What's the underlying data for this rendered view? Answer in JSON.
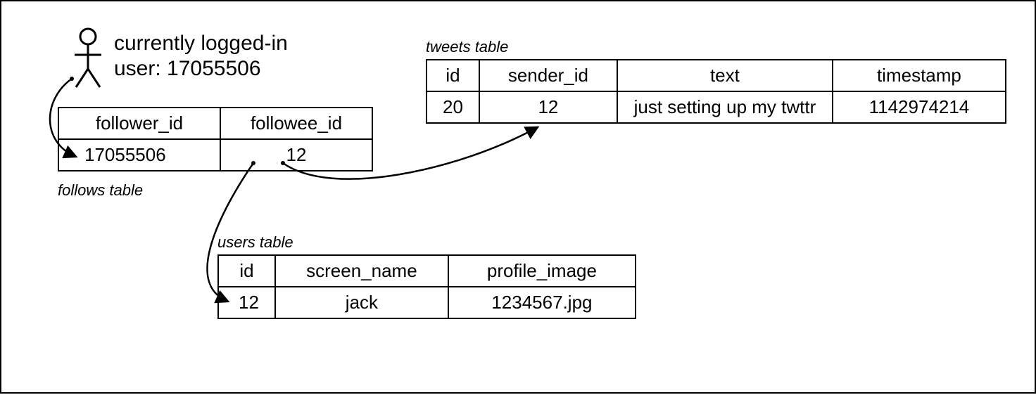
{
  "user": {
    "label_line1": "currently logged-in",
    "label_line2": "user: 17055506"
  },
  "follows": {
    "caption": "follows table",
    "headers": {
      "follower_id": "follower_id",
      "followee_id": "followee_id"
    },
    "row": {
      "follower_id": "17055506",
      "followee_id": "12"
    }
  },
  "tweets": {
    "caption": "tweets table",
    "headers": {
      "id": "id",
      "sender_id": "sender_id",
      "text": "text",
      "timestamp": "timestamp"
    },
    "row": {
      "id": "20",
      "sender_id": "12",
      "text": "just setting up my twttr",
      "timestamp": "1142974214"
    }
  },
  "users": {
    "caption": "users table",
    "headers": {
      "id": "id",
      "screen_name": "screen_name",
      "profile_image": "profile_image"
    },
    "row": {
      "id": "12",
      "screen_name": "jack",
      "profile_image": "1234567.jpg"
    }
  }
}
